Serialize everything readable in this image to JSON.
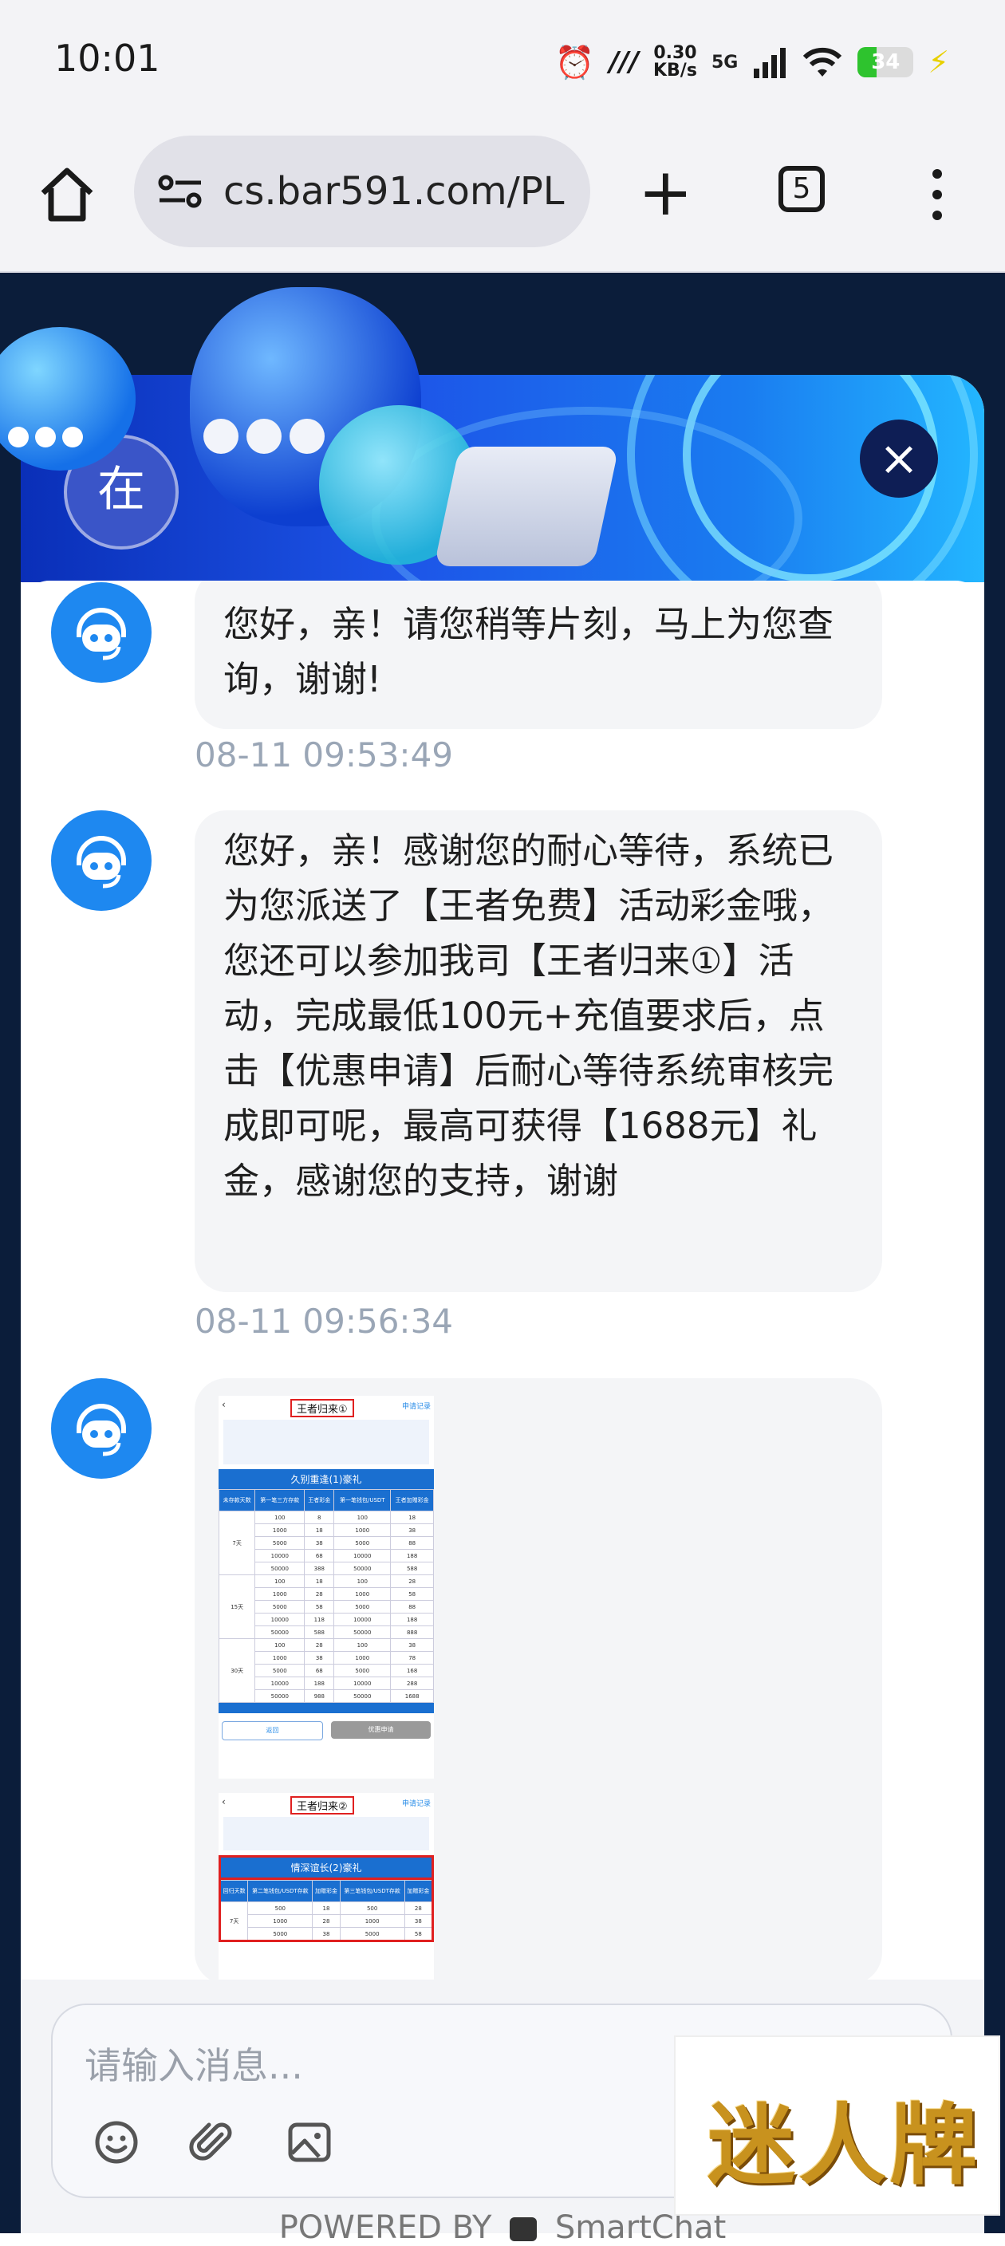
{
  "status_bar": {
    "time": "10:01",
    "speed_value": "0.30",
    "speed_unit": "KB/s",
    "network": "5G",
    "battery": "34"
  },
  "browser": {
    "url": "cs.bar591.com/PL",
    "tab_count": "5"
  },
  "chat": {
    "header_avatar_char": "在",
    "messages": [
      {
        "text": "您好，亲！请您稍等片刻，马上为您查询，谢谢!",
        "time": "08-11 09:53:49"
      },
      {
        "text": "您好，亲！感谢您的耐心等待，系统已为您派送了【王者免费】活动彩金哦，您还可以参加我司【王者归来①】活动，完成最低100元+充值要求后，点击【优惠申请】后耐心等待系统审核完成即可呢，最高可获得【1688元】礼金，感谢您的支持，谢谢",
        "time": "08-11 09:56:34"
      }
    ],
    "image_message": {
      "shot1": {
        "title": "王者归来①",
        "apply": "申请记录",
        "table_title": "久别重逢(1)豪礼",
        "headers": [
          "未存款天数",
          "第一笔三方存款",
          "王者彩金",
          "第一笔钱包/USDT",
          "王者加赠彩金"
        ],
        "groups": [
          {
            "days": "7天",
            "rows": [
              [
                "100",
                "8",
                "100",
                "18"
              ],
              [
                "1000",
                "18",
                "1000",
                "38"
              ],
              [
                "5000",
                "38",
                "5000",
                "88"
              ],
              [
                "10000",
                "68",
                "10000",
                "188"
              ],
              [
                "50000",
                "388",
                "50000",
                "588"
              ]
            ]
          },
          {
            "days": "15天",
            "rows": [
              [
                "100",
                "18",
                "100",
                "28"
              ],
              [
                "1000",
                "28",
                "1000",
                "58"
              ],
              [
                "5000",
                "58",
                "5000",
                "88"
              ],
              [
                "10000",
                "118",
                "10000",
                "188"
              ],
              [
                "50000",
                "588",
                "50000",
                "888"
              ]
            ]
          },
          {
            "days": "30天",
            "rows": [
              [
                "100",
                "28",
                "100",
                "38"
              ],
              [
                "1000",
                "38",
                "1000",
                "78"
              ],
              [
                "5000",
                "68",
                "5000",
                "168"
              ],
              [
                "10000",
                "188",
                "10000",
                "288"
              ],
              [
                "50000",
                "988",
                "50000",
                "1688"
              ]
            ]
          }
        ],
        "btn_back": "返回",
        "btn_apply": "优惠申请"
      },
      "shot2": {
        "title": "王者归来②",
        "apply": "申请记录",
        "table_title": "情深谊长(2)豪礼",
        "headers": [
          "回归天数",
          "第二笔钱包/USDT存款",
          "加赠彩金",
          "第三笔钱包/USDT存款",
          "加赠彩金"
        ],
        "days": "7天",
        "rows": [
          [
            "500",
            "18",
            "500",
            "28"
          ],
          [
            "1000",
            "28",
            "1000",
            "38"
          ],
          [
            "5000",
            "38",
            "5000",
            "58"
          ]
        ]
      }
    },
    "input_placeholder": "请输入消息...",
    "powered_by": "POWERED BY",
    "powered_brand": "SmartChat"
  },
  "watermark": "迷人牌"
}
